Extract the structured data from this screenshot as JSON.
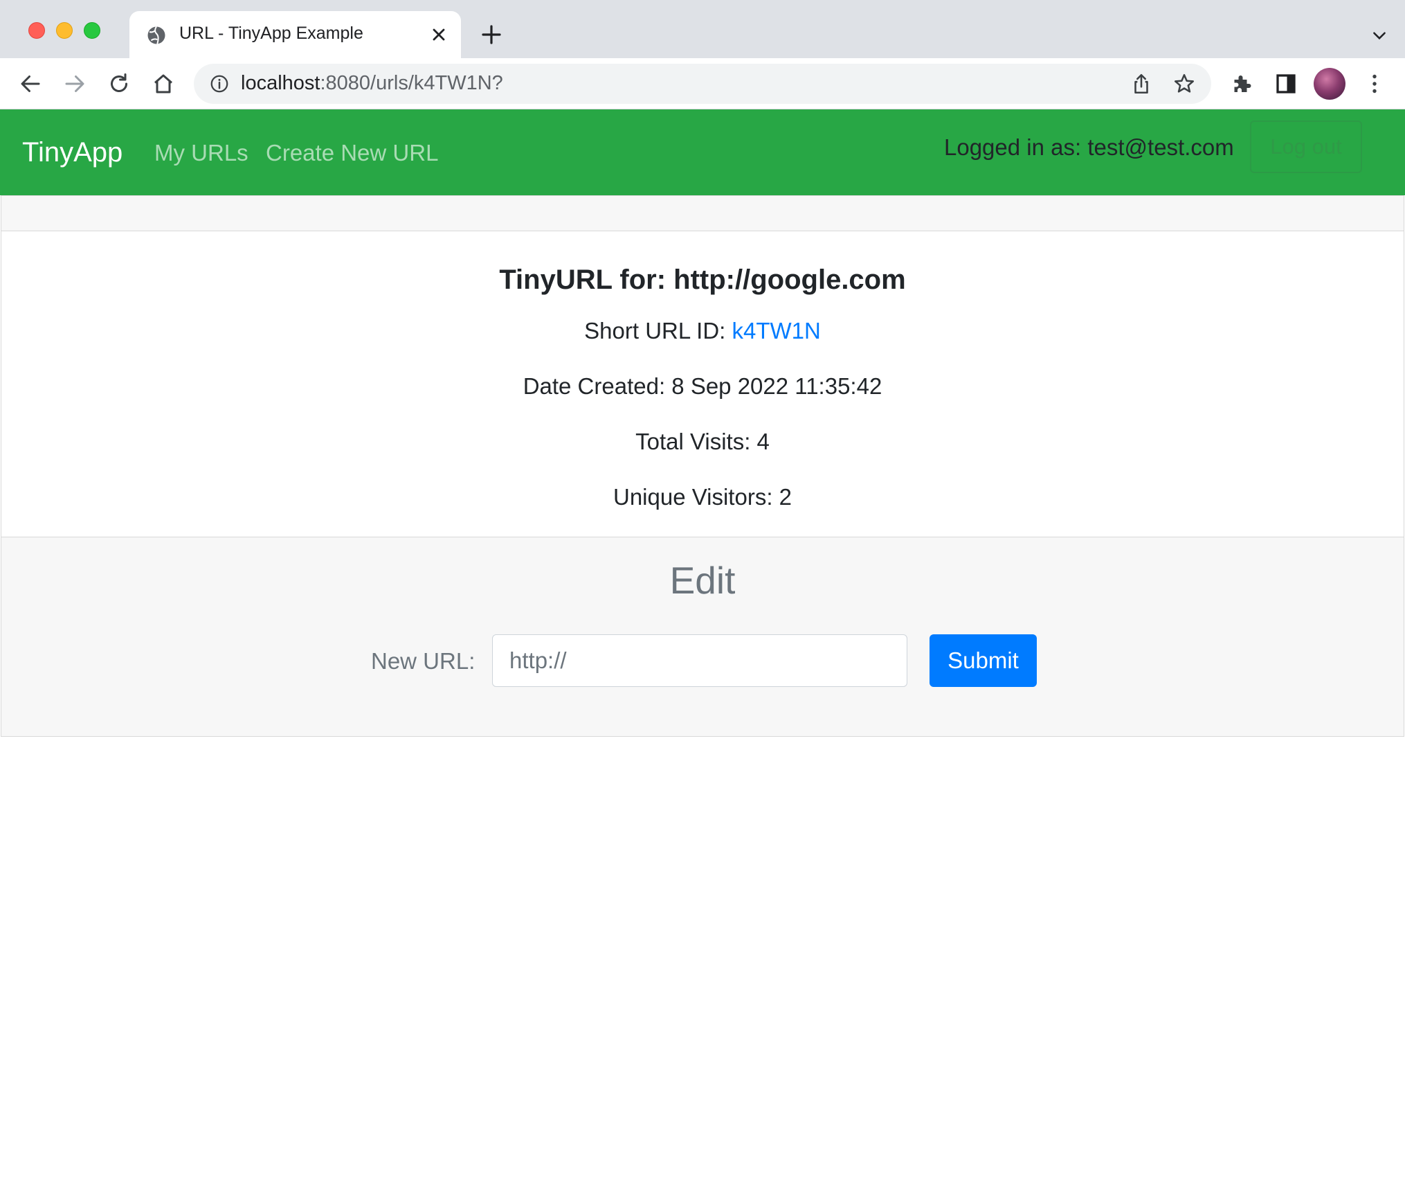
{
  "browser": {
    "tab_title": "URL - TinyApp Example",
    "url_host": "localhost",
    "url_rest": ":8080/urls/k4TW1N?"
  },
  "navbar": {
    "brand": "TinyApp",
    "links": [
      "My URLs",
      "Create New URL"
    ],
    "logged_in_text": "Logged in as: test@test.com",
    "logout_label": "Log out",
    "bg_color": "#28a745"
  },
  "card": {
    "title": "TinyURL for: http://google.com",
    "short_url_label": "Short URL ID: ",
    "short_url_id": "k4TW1N",
    "date_created": "Date Created: 8 Sep 2022 11:35:42",
    "total_visits": "Total Visits: 4",
    "unique_visitors": "Unique Visitors: 2"
  },
  "edit": {
    "heading": "Edit",
    "label": "New URL:",
    "placeholder": "http://",
    "submit_label": "Submit",
    "submit_color": "#007bff"
  }
}
